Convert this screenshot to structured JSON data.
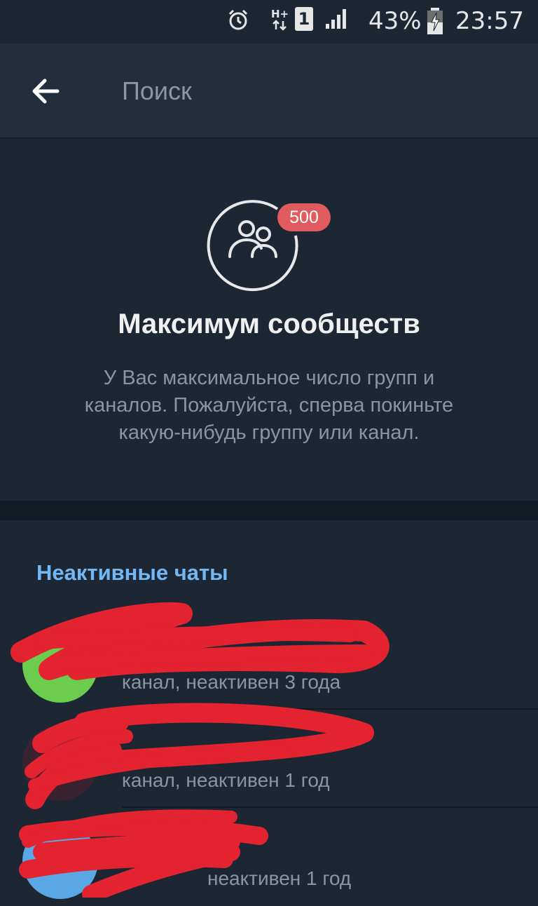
{
  "status_bar": {
    "network_type": "H+",
    "sim_slot": "1",
    "battery_percent": "43%",
    "time": "23:57",
    "icons": [
      "alarm-icon",
      "network-h-plus-icon",
      "sim-1-icon",
      "signal-icon",
      "battery-charging-icon"
    ]
  },
  "header": {
    "back_icon": "arrow-back-icon",
    "search_placeholder": "Поиск"
  },
  "limit_notice": {
    "icon": "group-users-icon",
    "badge_count": "500",
    "title": "Максимум сообществ",
    "description": "У Вас максимальное число групп и каналов. Пожалуйста, сперва покиньте какую-нибудь группу или канал."
  },
  "inactive_chats": {
    "header": "Неактивные чаты",
    "items": [
      {
        "name": "",
        "status": "канал, неактивен 3 года",
        "avatar_color": "#6ccc4e"
      },
      {
        "name": "",
        "status": "канал, неактивен 1 год",
        "avatar_color": "#3a2330"
      },
      {
        "name": "",
        "status": "неактивен 1 год",
        "avatar_color": "#5aa7e6"
      }
    ]
  },
  "colors": {
    "background": "#1d2733",
    "header_bg": "#232e3c",
    "accent_blue": "#71b8f4",
    "badge_red": "#e05a5e",
    "redaction_red": "#e3232f"
  }
}
